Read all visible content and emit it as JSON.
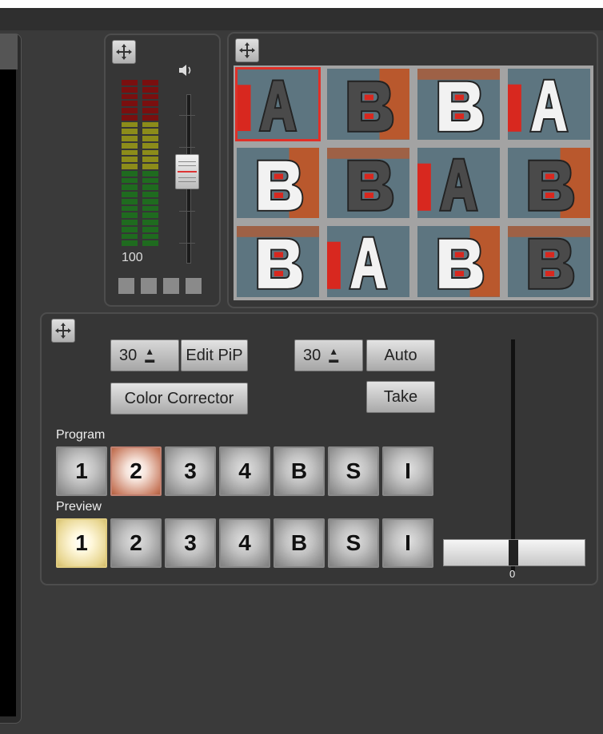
{
  "audio": {
    "level_label": "100",
    "fader_level": 0.55,
    "icon": "speaker-icon"
  },
  "transitions": {
    "count": 12,
    "selected_index": 0,
    "rows": [
      [
        "A",
        "B",
        "B",
        "A"
      ],
      [
        "B",
        "B",
        "A",
        "B"
      ],
      [
        "B",
        "A",
        "B",
        "B"
      ]
    ]
  },
  "switcher": {
    "left_duration": "30",
    "right_duration": "30",
    "edit_pip_label": "Edit PiP",
    "auto_label": "Auto",
    "color_corrector_label": "Color Corrector",
    "take_label": "Take",
    "program_label": "Program",
    "preview_label": "Preview",
    "program_buttons": [
      "1",
      "2",
      "3",
      "4",
      "B",
      "S",
      "I"
    ],
    "preview_buttons": [
      "1",
      "2",
      "3",
      "4",
      "B",
      "S",
      "I"
    ],
    "program_active": "2",
    "preview_active": "1",
    "tbar_value": "0"
  },
  "colors": {
    "selected_border": "#e03028",
    "program_active": "#c77a5e",
    "preview_active": "#e7d58f",
    "meter_red": "#7a0f0f",
    "meter_yellow": "#8c8c1a",
    "meter_green": "#1f6b1f"
  }
}
